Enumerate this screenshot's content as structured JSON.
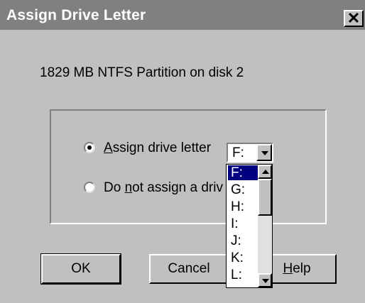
{
  "window": {
    "title": "Assign Drive Letter",
    "close_glyph": "✕"
  },
  "description": "1829 MB NTFS Partition on disk 2",
  "options": {
    "assign": {
      "prefix": "",
      "mnemonic": "A",
      "suffix": "ssign drive letter",
      "selected": true
    },
    "not_assign": {
      "prefix": "Do ",
      "mnemonic": "n",
      "suffix": "ot assign a driv",
      "selected": false
    }
  },
  "drive_combo": {
    "value": "F:",
    "options": [
      "F:",
      "G:",
      "H:",
      "I:",
      "J:",
      "K:",
      "L:"
    ],
    "selected_index": 0
  },
  "buttons": {
    "ok": "OK",
    "cancel": "Cancel",
    "help_prefix": "",
    "help_mnemonic": "H",
    "help_suffix": "elp"
  },
  "colors": {
    "title_bar": "#808080",
    "face": "#c0c0c0",
    "highlight": "#000080"
  }
}
